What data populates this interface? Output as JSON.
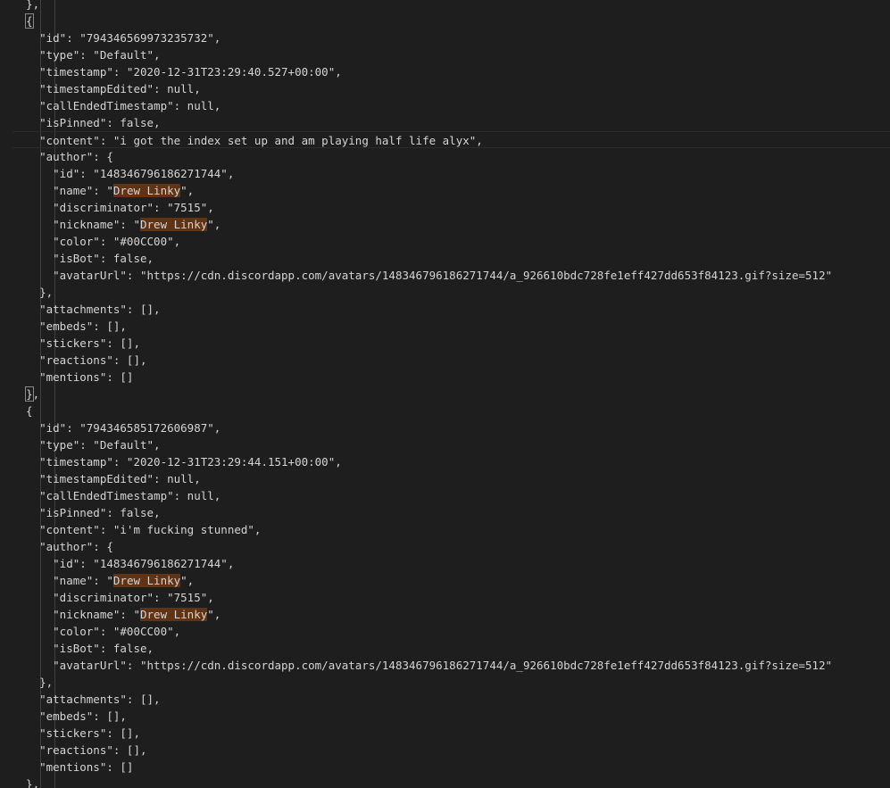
{
  "colors": {
    "background": "#1e1e1e",
    "text": "#d4d4d4",
    "search_highlight": "#613315"
  },
  "editor": {
    "lines": [
      {
        "text": "  },",
        "kind": "partial"
      },
      {
        "text": "  {",
        "kind": "bracket"
      },
      {
        "text": "    \"id\": \"794346569973235732\","
      },
      {
        "text": "    \"type\": \"Default\","
      },
      {
        "text": "    \"timestamp\": \"2020-12-31T23:29:40.527+00:00\","
      },
      {
        "text": "    \"timestampEdited\": null,"
      },
      {
        "text": "    \"callEndedTimestamp\": null,"
      },
      {
        "text": "    \"isPinned\": false,"
      },
      {
        "text": "    \"content\": \"i got the index set up and am playing half life alyx\",",
        "current": true
      },
      {
        "text": "    \"author\": {"
      },
      {
        "text": "      \"id\": \"148346796186271744\","
      },
      {
        "text": "      \"name\": \"Drew Linky\",",
        "highlight": "Drew Linky"
      },
      {
        "text": "      \"discriminator\": \"7515\","
      },
      {
        "text": "      \"nickname\": \"Drew Linky\",",
        "highlight": "Drew Linky"
      },
      {
        "text": "      \"color\": \"#00CC00\","
      },
      {
        "text": "      \"isBot\": false,"
      },
      {
        "text": "      \"avatarUrl\": \"https://cdn.discordapp.com/avatars/148346796186271744/a_926610bdc728fe1eff427dd653f84123.gif?size=512\""
      },
      {
        "text": "    },"
      },
      {
        "text": "    \"attachments\": [],"
      },
      {
        "text": "    \"embeds\": [],"
      },
      {
        "text": "    \"stickers\": [],"
      },
      {
        "text": "    \"reactions\": [],"
      },
      {
        "text": "    \"mentions\": []"
      },
      {
        "text": "  },",
        "kind": "bracket"
      },
      {
        "text": "  {"
      },
      {
        "text": "    \"id\": \"794346585172606987\","
      },
      {
        "text": "    \"type\": \"Default\","
      },
      {
        "text": "    \"timestamp\": \"2020-12-31T23:29:44.151+00:00\","
      },
      {
        "text": "    \"timestampEdited\": null,"
      },
      {
        "text": "    \"callEndedTimestamp\": null,"
      },
      {
        "text": "    \"isPinned\": false,"
      },
      {
        "text": "    \"content\": \"i'm fucking stunned\","
      },
      {
        "text": "    \"author\": {"
      },
      {
        "text": "      \"id\": \"148346796186271744\","
      },
      {
        "text": "      \"name\": \"Drew Linky\",",
        "highlight": "Drew Linky"
      },
      {
        "text": "      \"discriminator\": \"7515\","
      },
      {
        "text": "      \"nickname\": \"Drew Linky\",",
        "highlight": "Drew Linky"
      },
      {
        "text": "      \"color\": \"#00CC00\","
      },
      {
        "text": "      \"isBot\": false,"
      },
      {
        "text": "      \"avatarUrl\": \"https://cdn.discordapp.com/avatars/148346796186271744/a_926610bdc728fe1eff427dd653f84123.gif?size=512\""
      },
      {
        "text": "    },"
      },
      {
        "text": "    \"attachments\": [],"
      },
      {
        "text": "    \"embeds\": [],"
      },
      {
        "text": "    \"stickers\": [],"
      },
      {
        "text": "    \"reactions\": [],"
      },
      {
        "text": "    \"mentions\": []"
      },
      {
        "text": "  },"
      }
    ]
  }
}
